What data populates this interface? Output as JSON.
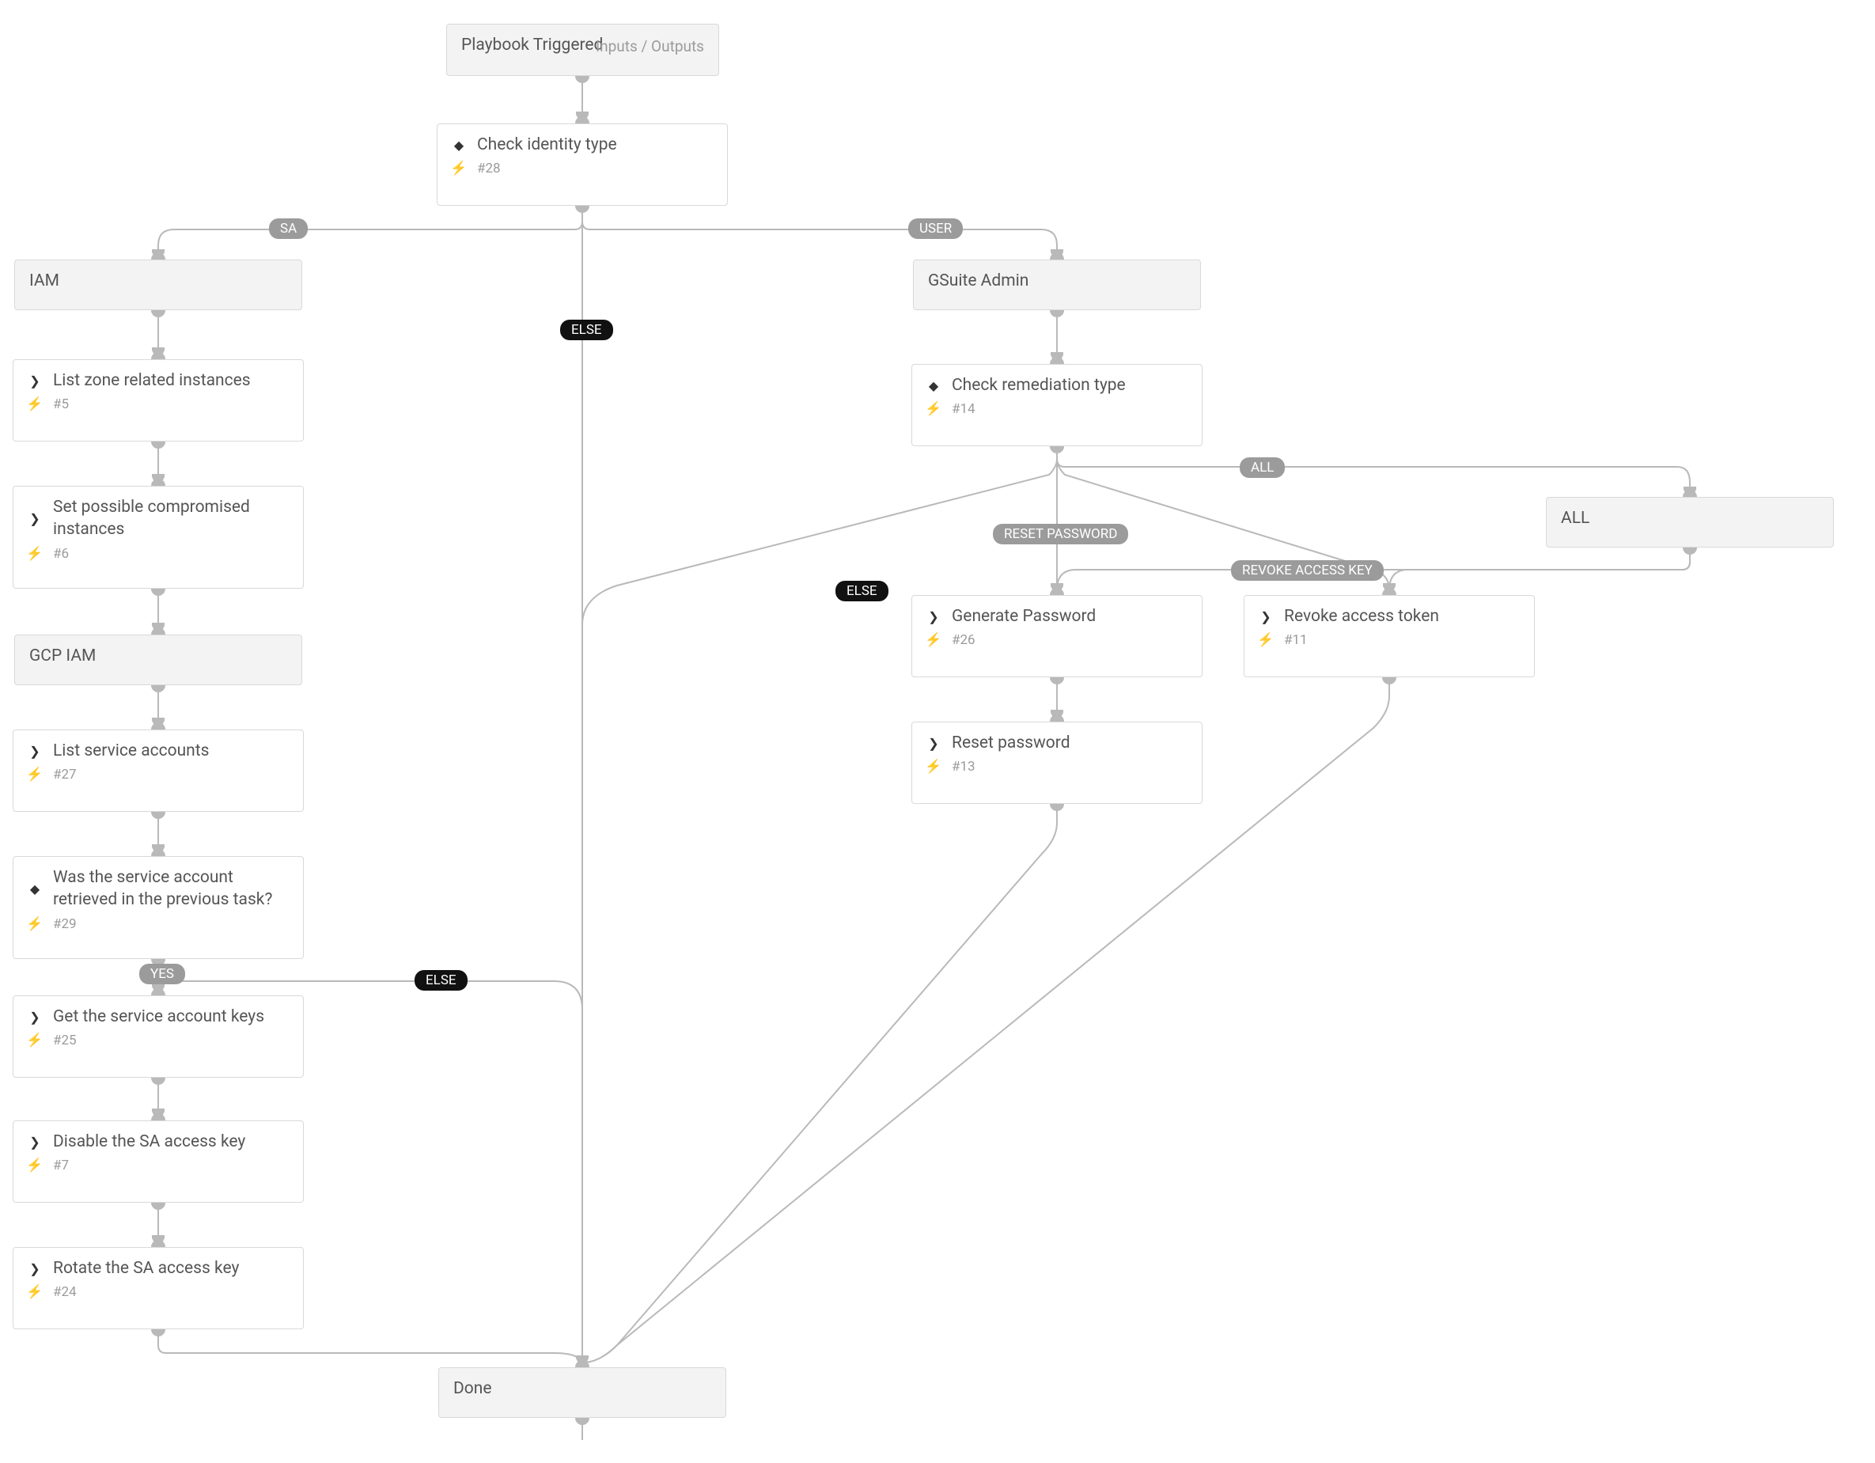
{
  "trigger": {
    "title": "Playbook Triggered",
    "io": "Inputs / Outputs"
  },
  "n28": {
    "title": "Check identity type",
    "id": "#28"
  },
  "iam": {
    "title": "IAM"
  },
  "gsuite": {
    "title": "GSuite Admin"
  },
  "allhdr": {
    "title": "ALL"
  },
  "n5": {
    "title": "List zone related instances",
    "id": "#5"
  },
  "n6": {
    "title": "Set possible compromised instances",
    "id": "#6"
  },
  "gcpiam": {
    "title": "GCP IAM"
  },
  "n27": {
    "title": "List service accounts",
    "id": "#27"
  },
  "n29": {
    "title": "Was the service account retrieved in the previous task?",
    "id": "#29"
  },
  "n25": {
    "title": "Get the service account keys",
    "id": "#25"
  },
  "n7": {
    "title": "Disable the SA access key",
    "id": "#7"
  },
  "n24": {
    "title": "Rotate the SA access key",
    "id": "#24"
  },
  "n14": {
    "title": "Check remediation type",
    "id": "#14"
  },
  "n26": {
    "title": "Generate Password",
    "id": "#26"
  },
  "n13": {
    "title": "Reset password",
    "id": "#13"
  },
  "n11": {
    "title": "Revoke access token",
    "id": "#11"
  },
  "done": {
    "title": "Done"
  },
  "labels": {
    "sa": "SA",
    "user": "USER",
    "else1": "ELSE",
    "else2": "ELSE",
    "else3": "ELSE",
    "all": "ALL",
    "reset": "RESET PASSWORD",
    "revoke": "REVOKE ACCESS KEY",
    "yes": "YES"
  }
}
